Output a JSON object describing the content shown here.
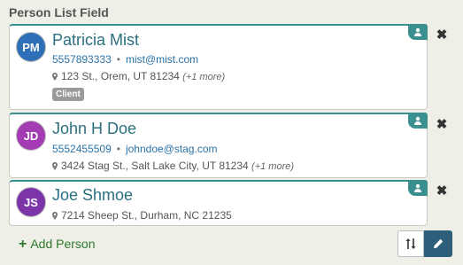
{
  "field": {
    "label": "Person List Field"
  },
  "people": [
    {
      "initials": "PM",
      "avatar_color": "#2f6fb8",
      "name": "Patricia Mist",
      "phone": "5557893333",
      "email": "mist@mist.com",
      "address": "123 St., Orem, UT 81234",
      "more": "(+1 more)",
      "tag": "Client"
    },
    {
      "initials": "JD",
      "avatar_color": "#a33bb3",
      "name": "John H Doe",
      "phone": "5552455509",
      "email": "johndoe@stag.com",
      "address": "3424 Stag St., Salt Lake City, UT 81234",
      "more": "(+1 more)"
    },
    {
      "initials": "JS",
      "avatar_color": "#7b35a8",
      "name": "Joe Shmoe",
      "address": "7214 Sheep St., Durham, NC 21235"
    }
  ],
  "separator": "•",
  "actions": {
    "add_label": "Add Person",
    "add_icon": "+"
  },
  "colors": {
    "accent": "#3a8f8f",
    "link": "#2a73a8",
    "add": "#2d7a2d",
    "edit_button": "#2d5f7a"
  }
}
